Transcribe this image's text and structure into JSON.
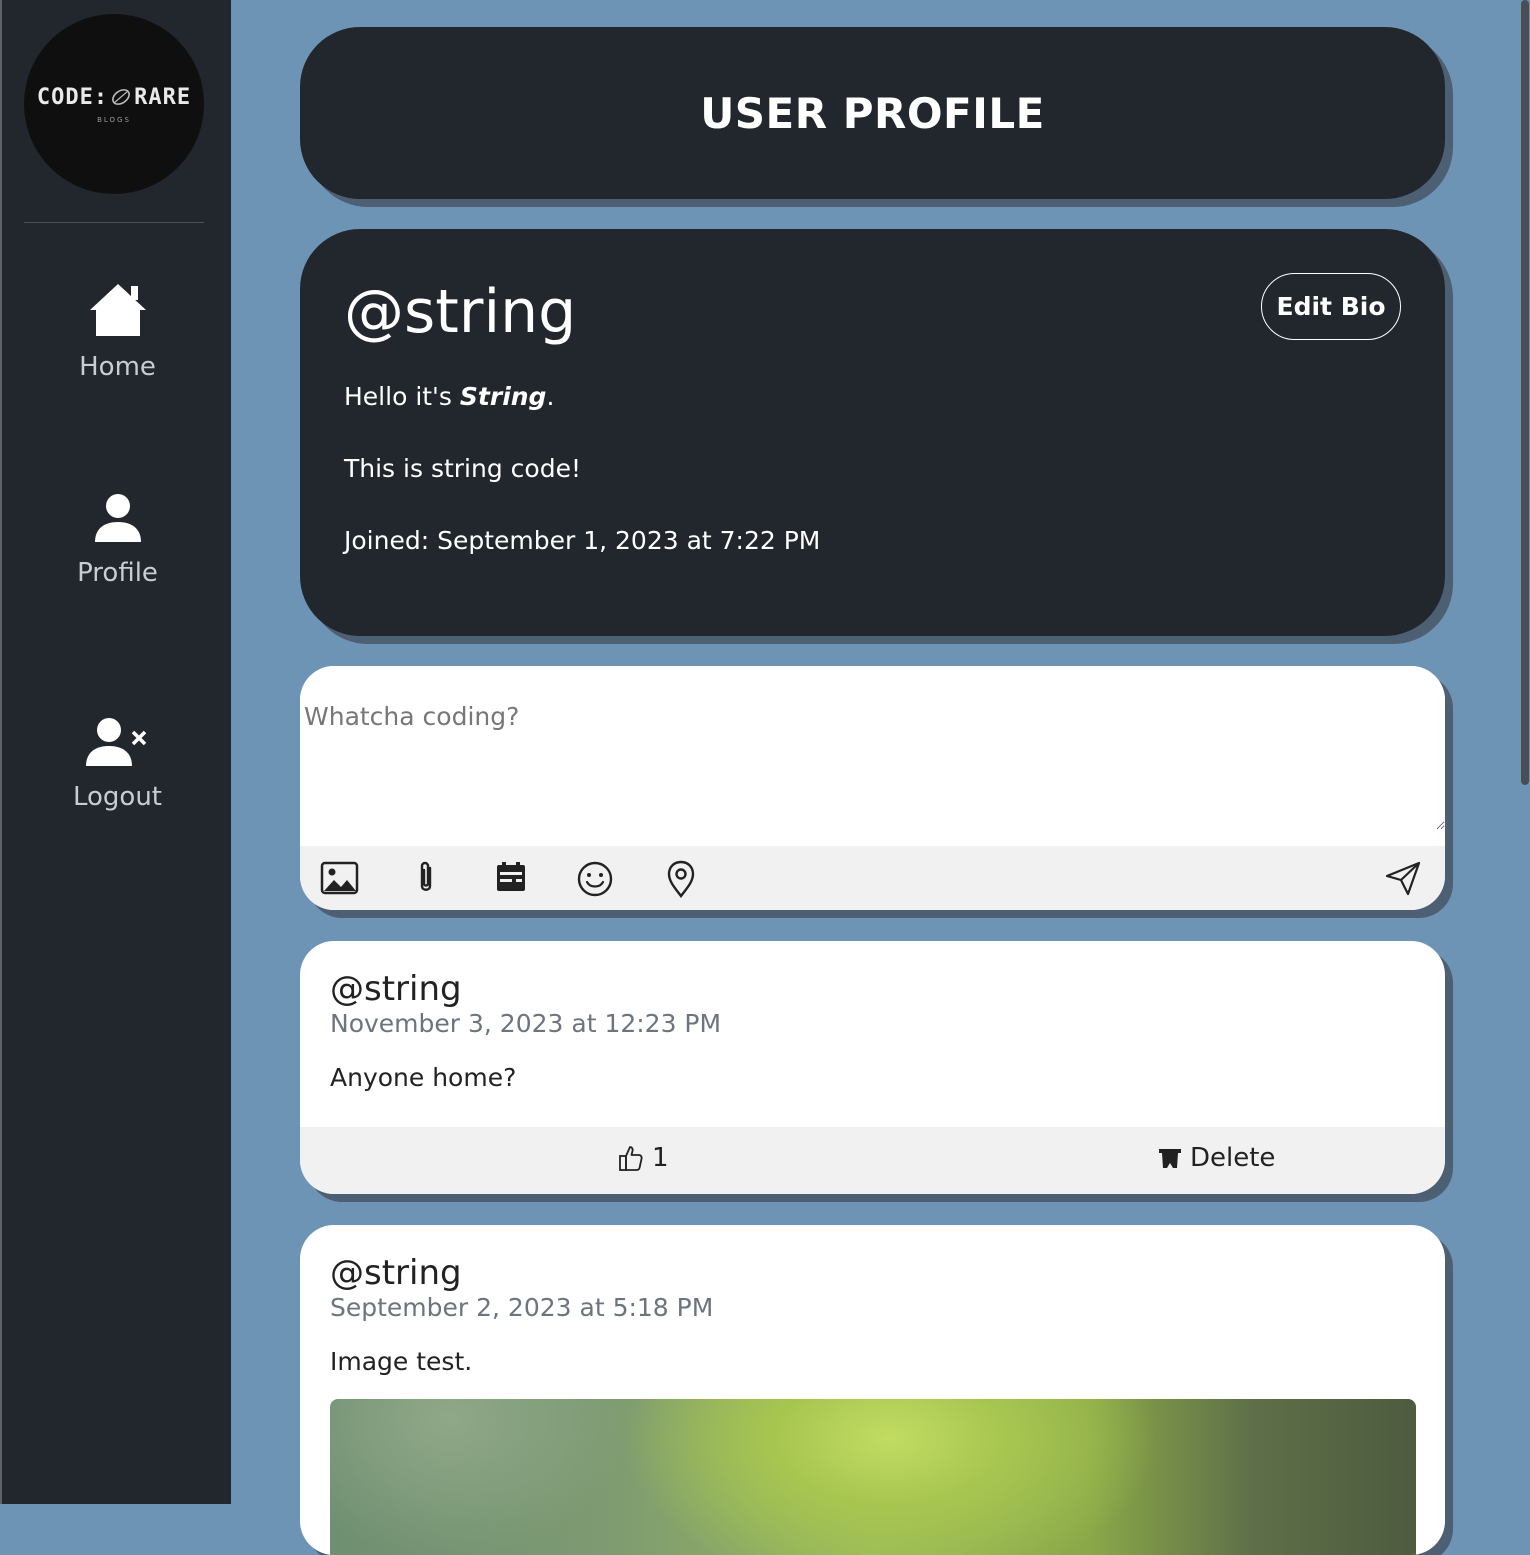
{
  "sidebar": {
    "logo": {
      "main_left": "CODE:",
      "main_right": "RARE",
      "sub": "BLOGS"
    },
    "items": [
      {
        "label": "Home",
        "icon": "home-icon"
      },
      {
        "label": "Profile",
        "icon": "user-icon"
      },
      {
        "label": "Logout",
        "icon": "user-remove-icon"
      }
    ]
  },
  "header": {
    "title": "USER PROFILE"
  },
  "profile": {
    "username": "@string",
    "edit_bio_label": "Edit Bio",
    "bio_line1_prefix": "Hello it's ",
    "bio_line1_emphasis": "String",
    "bio_line1_suffix": ".",
    "bio_line2": "This is string code!",
    "joined": "Joined: September 1, 2023 at 7:22 PM"
  },
  "composer": {
    "placeholder": "Whatcha coding?",
    "tools": [
      "image-icon",
      "paperclip-icon",
      "calendar-icon",
      "emoji-icon",
      "location-pin-icon"
    ],
    "send_icon": "send-icon"
  },
  "posts": [
    {
      "username": "@string",
      "date": "November 3, 2023 at 12:23 PM",
      "body": "Anyone home?",
      "likes": "1",
      "delete_label": "Delete"
    },
    {
      "username": "@string",
      "date": "September 2, 2023 at 5:18 PM",
      "body": "Image test."
    }
  ],
  "colors": {
    "background": "#6e94b5",
    "sidebar": "#22262d",
    "card_dark": "#22262d",
    "card_light": "#ffffff",
    "toolbar": "#f1f1f1",
    "muted_text": "#6c757d"
  }
}
